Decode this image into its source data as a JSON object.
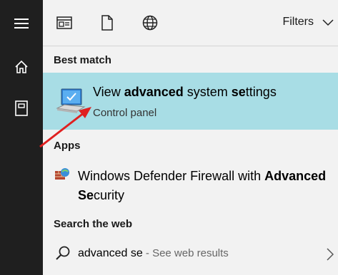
{
  "leftbar": {
    "icons": [
      "hamburger-icon",
      "home-icon",
      "notebook-icon"
    ]
  },
  "topbar": {
    "icons": [
      "documents-icon",
      "file-icon",
      "web-globe-icon"
    ],
    "filters_label": "Filters"
  },
  "best_match": {
    "heading": "Best match",
    "title_parts": {
      "t1": "View ",
      "t2": "advanced",
      "t3": " system ",
      "t4": "se",
      "t5": "ttings"
    },
    "subtitle": "Control panel"
  },
  "apps": {
    "heading": "Apps",
    "item": {
      "t1": "Windows Defender Firewall with ",
      "t2": "Advanced",
      "t3": " ",
      "t4": "Se",
      "t5": "curity"
    }
  },
  "web": {
    "heading": "Search the web",
    "query": "advanced se",
    "hint": " - See web results"
  },
  "colors": {
    "leftbar_bg": "#1f1f1f",
    "panel_bg": "#f2f2f2",
    "best_match_highlight": "#a8dde5",
    "annotation_arrow": "#e02020"
  }
}
